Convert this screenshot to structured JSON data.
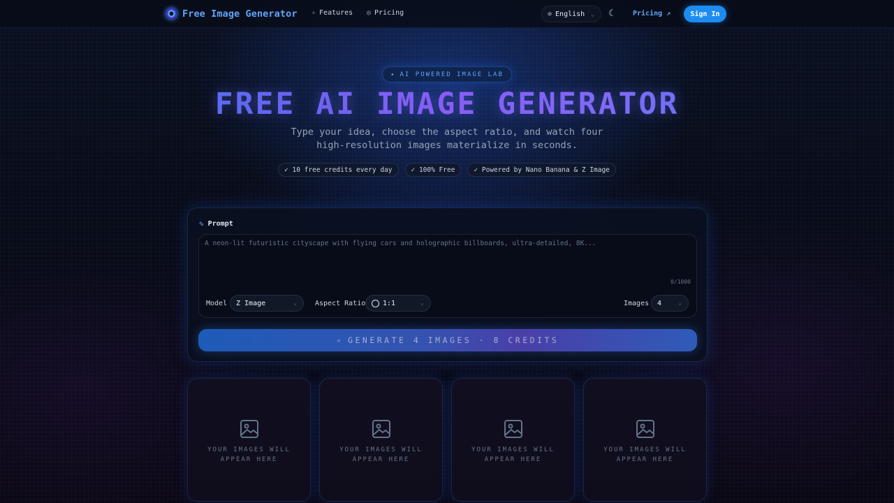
{
  "nav": {
    "brand": "Free Image Generator",
    "links": [
      {
        "label": "Features",
        "icon": "sparkles-icon"
      },
      {
        "label": "Pricing",
        "icon": "coin-icon"
      }
    ],
    "language": "English",
    "pricing_link": "Pricing ↗",
    "sign_in": "Sign In"
  },
  "hero": {
    "badge": "AI POWERED IMAGE LAB",
    "title": "FREE AI IMAGE GENERATOR",
    "subtitle_line1": "Type your idea, choose the aspect ratio, and watch four",
    "subtitle_line2": "high-resolution images materialize in seconds.",
    "chips": [
      "✓ 10 free credits every day",
      "✓ 100% Free",
      "✓ Powered by Nano Banana & Z Image"
    ]
  },
  "form": {
    "prompt_label": "Prompt",
    "prompt_placeholder": "A neon-lit futuristic cityscape with flying cars and holographic billboards, ultra-detailed, 8K...",
    "char_counter": "0/1000",
    "model_label": "Model",
    "model_value": "Z Image",
    "aspect_label": "Aspect Ratio",
    "aspect_value": "1:1",
    "images_label": "Images",
    "images_value": "4",
    "generate_label": "GENERATE 4 IMAGES · 8 CREDITS"
  },
  "results": {
    "placeholder_line1": "YOUR IMAGES WILL",
    "placeholder_line2": "APPEAR HERE"
  },
  "colors": {
    "accent": "#1d8cf0",
    "title_gradient_start": "#3b82f6",
    "title_gradient_mid": "#8b5cf6"
  }
}
